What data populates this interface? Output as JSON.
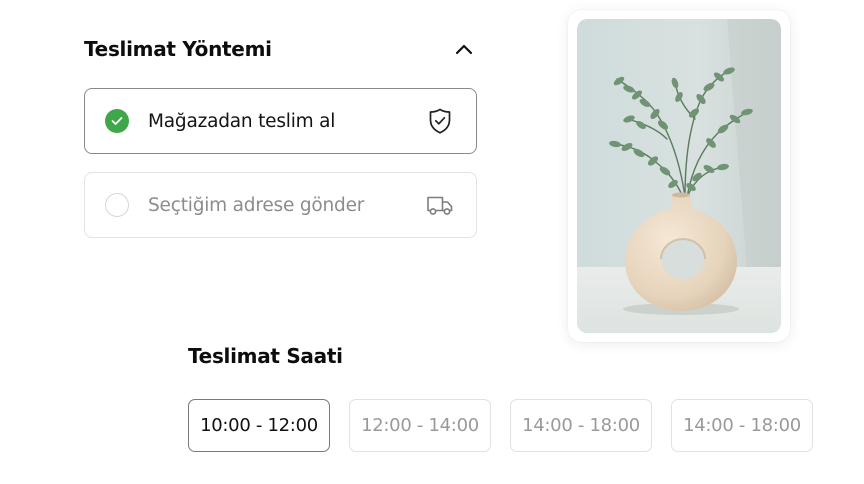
{
  "delivery_method": {
    "title": "Teslimat Yöntemi",
    "collapse_icon": "chevron-up-icon",
    "options": [
      {
        "label": "Mağazadan teslim al",
        "selected": true,
        "icon": "shield-check-icon"
      },
      {
        "label": "Seçtiğim adrese gönder",
        "selected": false,
        "icon": "truck-icon"
      }
    ]
  },
  "product_image": {
    "subject": "plant-in-vase-photo"
  },
  "delivery_time": {
    "title": "Teslimat Saati",
    "slots": [
      {
        "label": "10:00 - 12:00",
        "selected": true
      },
      {
        "label": "12:00 - 14:00",
        "selected": false
      },
      {
        "label": "14:00 - 18:00",
        "selected": false
      },
      {
        "label": "14:00 - 18:00",
        "selected": false
      }
    ]
  },
  "colors": {
    "accent_green": "#3fa64a",
    "selected_border": "#8a8a8a",
    "inactive_border": "#e3e3e3",
    "inactive_text": "#9a9a9a"
  }
}
